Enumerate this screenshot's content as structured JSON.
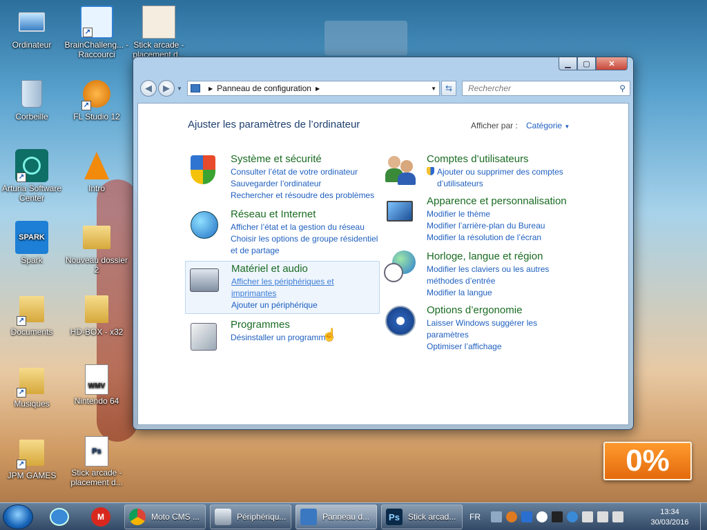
{
  "desktop": {
    "icons": [
      {
        "label": "Ordinateur"
      },
      {
        "label": "BrainChalleng... - Raccourci"
      },
      {
        "label": "Stick arcade - placement d..."
      },
      {
        "label": "Corbeille"
      },
      {
        "label": "FL Studio 12"
      },
      {
        "label": "Arturia Software Center"
      },
      {
        "label": "Intro"
      },
      {
        "label": "Spark"
      },
      {
        "label": "Nouveau dossier 2"
      },
      {
        "label": "Documents"
      },
      {
        "label": "HD-BOX - x32"
      },
      {
        "label": "Musiques"
      },
      {
        "label": "Nintendo 64"
      },
      {
        "label": "JPM GAMES"
      },
      {
        "label": "Stick arcade - placement d..."
      }
    ],
    "spark_text": "SPARK",
    "ps_text": "Ps",
    "wmv_text": "WMV",
    "overlay_percent": "0%"
  },
  "window": {
    "address": {
      "location": "Panneau de configuration"
    },
    "search": {
      "placeholder": "Rechercher"
    },
    "heading": "Ajuster les paramètres de l’ordinateur",
    "view_by": {
      "label": "Afficher par :",
      "value": "Catégorie"
    },
    "categories": [
      {
        "title": "Système et sécurité",
        "links": [
          "Consulter l’état de votre ordinateur",
          "Sauvegarder l’ordinateur",
          "Rechercher et résoudre des problèmes"
        ]
      },
      {
        "title": "Réseau et Internet",
        "links": [
          "Afficher l’état et la gestion du réseau",
          "Choisir les options de groupe résidentiel et de partage"
        ]
      },
      {
        "title": "Matériel et audio",
        "links": [
          "Afficher les périphériques et imprimantes",
          "Ajouter un périphérique"
        ]
      },
      {
        "title": "Programmes",
        "links": [
          "Désinstaller un programme"
        ]
      },
      {
        "title": "Comptes d’utilisateurs",
        "links": [
          "Ajouter ou supprimer des comptes d’utilisateurs"
        ]
      },
      {
        "title": "Apparence et personnalisation",
        "links": [
          "Modifier le thème",
          "Modifier l’arrière-plan du Bureau",
          "Modifier la résolution de l’écran"
        ]
      },
      {
        "title": "Horloge, langue et région",
        "links": [
          "Modifier les claviers ou les autres méthodes d’entrée",
          "Modifier la langue"
        ]
      },
      {
        "title": "Options d’ergonomie",
        "links": [
          "Laisser Windows suggérer les paramètres",
          "Optimiser l’affichage"
        ]
      }
    ]
  },
  "taskbar": {
    "tasks": [
      {
        "label": "Moto CMS ..."
      },
      {
        "label": "Périphériqu..."
      },
      {
        "label": "Panneau d..."
      },
      {
        "label": "Stick arcad..."
      }
    ],
    "ps_text": "Ps",
    "language": "FR",
    "time": "13:34",
    "date": "30/03/2016"
  }
}
